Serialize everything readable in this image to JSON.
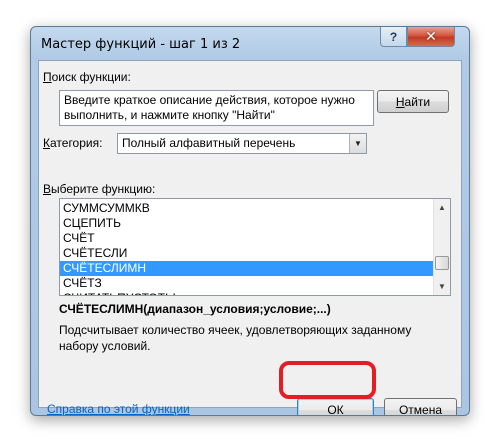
{
  "dialog": {
    "title": "Мастер функций - шаг 1 из 2",
    "help_btn": "?",
    "close_btn": "✕"
  },
  "search": {
    "label_first": "П",
    "label_rest": "оиск функции:",
    "description": "Введите краткое описание действия, которое нужно выполнить, и нажмите кнопку \"Найти\"",
    "find_button_first": "Н",
    "find_button_rest": "айти"
  },
  "category": {
    "label_first": "К",
    "label_rest": "атегория:",
    "selected": "Полный алфавитный перечень",
    "arrow": "▼"
  },
  "function_list": {
    "label_first": "В",
    "label_rest": "ыберите функцию:",
    "items": [
      "СУММСУММКВ",
      "СЦЕПИТЬ",
      "СЧЁТ",
      "СЧЁТЕСЛИ",
      "СЧЁТЕСЛИМН",
      "СЧЁТЗ",
      "СЧИТАТЬПУСТОТЫ"
    ],
    "selected_index": 4,
    "scroll_up": "▲",
    "scroll_down": "▼"
  },
  "selected_function": {
    "signature": "СЧЁТЕСЛИМН(диапазон_условия;условие;...)",
    "description": "Подсчитывает количество ячеек, удовлетворяющих заданному набору условий."
  },
  "footer": {
    "help_link": "Справка по этой функции",
    "ok_label": "ОК",
    "cancel_label": "Отмена"
  },
  "colors": {
    "selection": "#3399ff",
    "highlight_ring": "#e31e24",
    "link": "#0066cc"
  }
}
